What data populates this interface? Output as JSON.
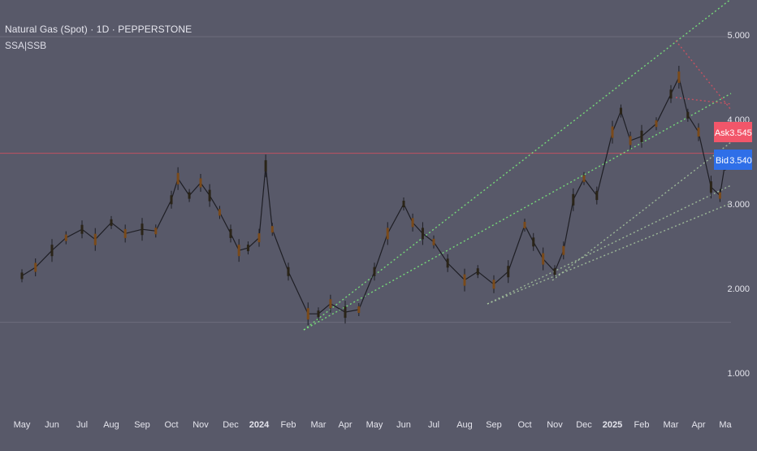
{
  "header": {
    "symbol_title": "Natural Gas (Spot) · 1D · PEPPERSTONE",
    "indicator_label": "SSA|SSB"
  },
  "colors": {
    "background": "#585969",
    "axis_text": "#e4e4ec",
    "candle_body": "#2a2418",
    "candle_accent": "#7a4a1a",
    "wick": "#1e1e24",
    "channel_bright": "#7cf07c",
    "channel_dim": "#a8c8a0",
    "resistance_red": "#d85060",
    "grid_line": "#6c6d7c",
    "ask_badge": "#f2566a",
    "bid_badge": "#2f6fe8"
  },
  "quote": {
    "ask_label": "Ask",
    "ask_value": "3.545",
    "bid_label": "Bid",
    "bid_value": "3.540"
  },
  "chart_data": {
    "type": "line",
    "title": "Natural Gas (Spot) · 1D · PEPPERSTONE",
    "style": "candlestick",
    "x_tick_labels": [
      "May",
      "Jun",
      "Jul",
      "Aug",
      "Sep",
      "Oct",
      "Nov",
      "Dec",
      "2024",
      "Feb",
      "Mar",
      "Apr",
      "May",
      "Jun",
      "Jul",
      "Aug",
      "Sep",
      "Oct",
      "Nov",
      "Dec",
      "2025",
      "Feb",
      "Mar",
      "Apr",
      "Ma"
    ],
    "y_tick_labels": [
      "5.000",
      "4.000",
      "3.000",
      "2.000",
      "1.000"
    ],
    "y_scale": "linear",
    "ylim": [
      0.75,
      5.25
    ],
    "grid": false,
    "series": [
      {
        "x": [
          "2023-05-01",
          "2023-05-15",
          "2023-06-01",
          "2023-06-15",
          "2023-07-01",
          "2023-07-15",
          "2023-08-01",
          "2023-08-15",
          "2023-09-01",
          "2023-09-15",
          "2023-10-01",
          "2023-10-08",
          "2023-10-20",
          "2023-11-01",
          "2023-11-10",
          "2023-11-20",
          "2023-12-01",
          "2023-12-10",
          "2023-12-20",
          "2024-01-01",
          "2024-01-08",
          "2024-01-15",
          "2024-02-01",
          "2024-02-20",
          "2024-03-01",
          "2024-03-15",
          "2024-04-01",
          "2024-04-15",
          "2024-05-01",
          "2024-05-15",
          "2024-06-01",
          "2024-06-10",
          "2024-06-20",
          "2024-07-01",
          "2024-07-15",
          "2024-08-01",
          "2024-08-15",
          "2024-09-01",
          "2024-09-15",
          "2024-10-01",
          "2024-10-10",
          "2024-10-20",
          "2024-11-01",
          "2024-11-10",
          "2024-11-20",
          "2024-12-01",
          "2024-12-15",
          "2025-01-01",
          "2025-01-10",
          "2025-01-20",
          "2025-02-01",
          "2025-02-15",
          "2025-03-01",
          "2025-03-10",
          "2025-03-20",
          "2025-04-01",
          "2025-04-15",
          "2025-04-25",
          "2025-05-01"
        ],
        "y": [
          2.15,
          2.25,
          2.45,
          2.6,
          2.7,
          2.58,
          2.78,
          2.65,
          2.7,
          2.68,
          3.05,
          3.3,
          3.1,
          3.25,
          3.1,
          2.9,
          2.65,
          2.45,
          2.48,
          2.6,
          3.45,
          2.7,
          2.2,
          1.7,
          1.7,
          1.82,
          1.72,
          1.75,
          2.2,
          2.65,
          3.0,
          2.78,
          2.65,
          2.55,
          2.3,
          2.1,
          2.2,
          2.05,
          2.2,
          2.75,
          2.55,
          2.35,
          2.2,
          2.45,
          3.05,
          3.3,
          3.1,
          3.85,
          4.1,
          3.75,
          3.8,
          3.95,
          4.3,
          4.5,
          4.05,
          3.85,
          3.2,
          3.1,
          3.5
        ]
      }
    ],
    "overlays": {
      "horizontal_levels": [
        4.98,
        3.6,
        1.6
      ],
      "resistance_level_label": "3.540"
    }
  }
}
